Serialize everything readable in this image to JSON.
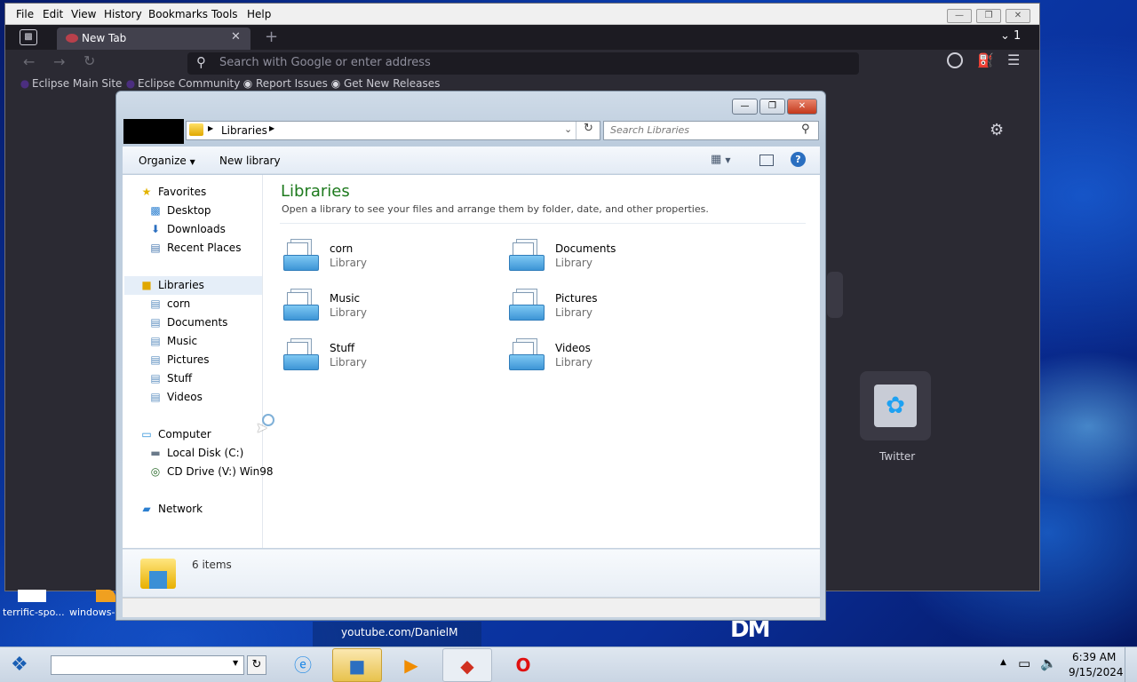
{
  "browser": {
    "menu": [
      "File",
      "Edit",
      "View",
      "History",
      "Bookmarks",
      "Tools",
      "Help"
    ],
    "tab_title": "New Tab",
    "tab_count": "1",
    "address_placeholder": "Search with Google or enter address",
    "bookmarks": [
      "Eclipse Main Site",
      "Eclipse Community",
      "Report Issues",
      "Get New Releases"
    ],
    "shortcut_label": "Twitter"
  },
  "explorer": {
    "breadcrumb": "Libraries",
    "search_placeholder": "Search Libraries",
    "toolbar": {
      "organize": "Organize",
      "new_library": "New library"
    },
    "nav": {
      "favorites": "Favorites",
      "favorites_items": [
        "Desktop",
        "Downloads",
        "Recent Places"
      ],
      "libraries": "Libraries",
      "libraries_items": [
        "corn",
        "Documents",
        "Music",
        "Pictures",
        "Stuff",
        "Videos"
      ],
      "computer": "Computer",
      "computer_items": [
        "Local Disk (C:)",
        "CD Drive (V:) Win98"
      ],
      "network": "Network"
    },
    "heading": "Libraries",
    "subheading": "Open a library to see your files and arrange them by folder, date, and other properties.",
    "libraries": [
      {
        "name": "corn",
        "type": "Library"
      },
      {
        "name": "Documents",
        "type": "Library"
      },
      {
        "name": "Music",
        "type": "Library"
      },
      {
        "name": "Pictures",
        "type": "Library"
      },
      {
        "name": "Stuff",
        "type": "Library"
      },
      {
        "name": "Videos",
        "type": "Library"
      }
    ],
    "item_count": "6 items"
  },
  "desktop": {
    "icons": [
      "terrific-spo...",
      "windows-"
    ],
    "watermark": "youtube.com/DanielM",
    "logo": "DM"
  },
  "taskbar": {
    "clock_time": "6:39 AM",
    "clock_date": "9/15/2024"
  },
  "colors": {
    "heading_green": "#1e7a1e",
    "accent_blue": "#2b6fc0"
  }
}
